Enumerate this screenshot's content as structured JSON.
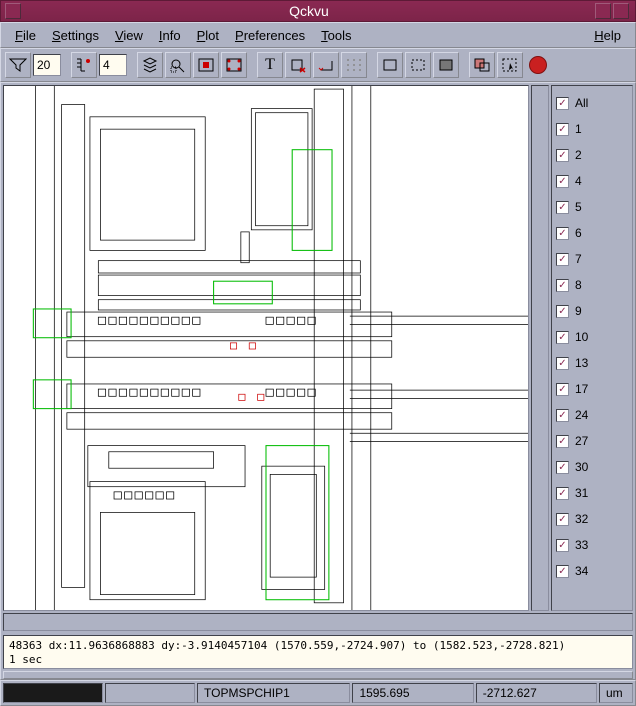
{
  "window": {
    "title": "Qckvu"
  },
  "menu": {
    "file": "File",
    "settings": "Settings",
    "view": "View",
    "info": "Info",
    "plot": "Plot",
    "preferences": "Preferences",
    "tools": "Tools",
    "help": "Help"
  },
  "toolbar": {
    "filter_value": "20",
    "nest_value": "4"
  },
  "layers": {
    "all_label": "All",
    "items": [
      "1",
      "2",
      "4",
      "5",
      "6",
      "7",
      "8",
      "9",
      "10",
      "13",
      "17",
      "24",
      "27",
      "30",
      "31",
      "32",
      "33",
      "34"
    ]
  },
  "status": {
    "line1": "48363 dx:11.9636868883 dy:-3.9140457104 (1570.559,-2724.907) to (1582.523,-2728.821)",
    "line2": "1 sec"
  },
  "footer": {
    "progress": "",
    "blank1": "",
    "cell": "TOPMSPCHIP1",
    "x": "1595.695",
    "y": "-2712.627",
    "unit": "um"
  }
}
